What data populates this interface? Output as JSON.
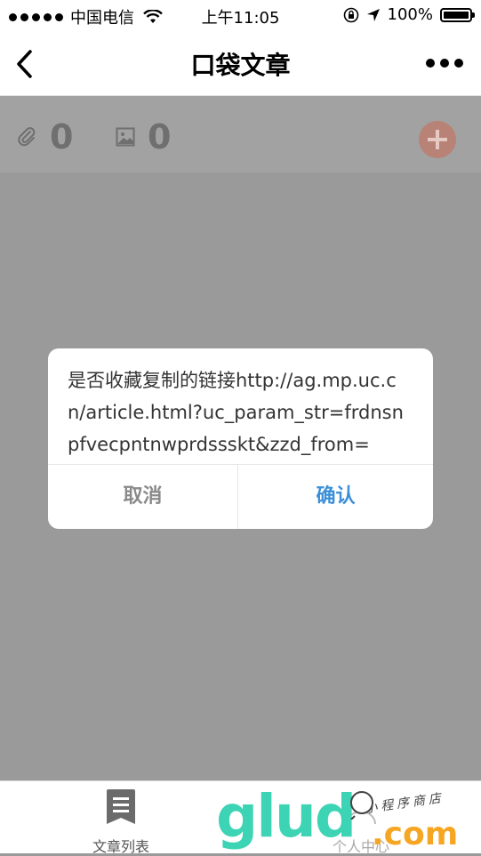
{
  "status_bar": {
    "carrier": "中国电信",
    "time": "上午11:05",
    "battery": "100%"
  },
  "nav": {
    "title": "口袋文章"
  },
  "counts": {
    "attachments": "0",
    "images": "0"
  },
  "dialog": {
    "message": "是否收藏复制的链接http://ag.mp.uc.cn/article.html?uc_param_str=frdnsnpfvecpntnwprdssskt&zzd_from=",
    "cancel_label": "取消",
    "confirm_label": "确认"
  },
  "tabbar": {
    "items": [
      {
        "label": "文章列表",
        "icon": "article-list-icon"
      },
      {
        "label": "个人中心",
        "icon": "profile-icon"
      }
    ]
  },
  "watermark": {
    "brand": "glud",
    "domain": ".com",
    "tagline": "小程序商店"
  },
  "colors": {
    "confirm": "#3a8fd8",
    "add_button": "#b88276",
    "watermark_teal": "#3cd4b4",
    "watermark_orange": "#f5a623"
  }
}
